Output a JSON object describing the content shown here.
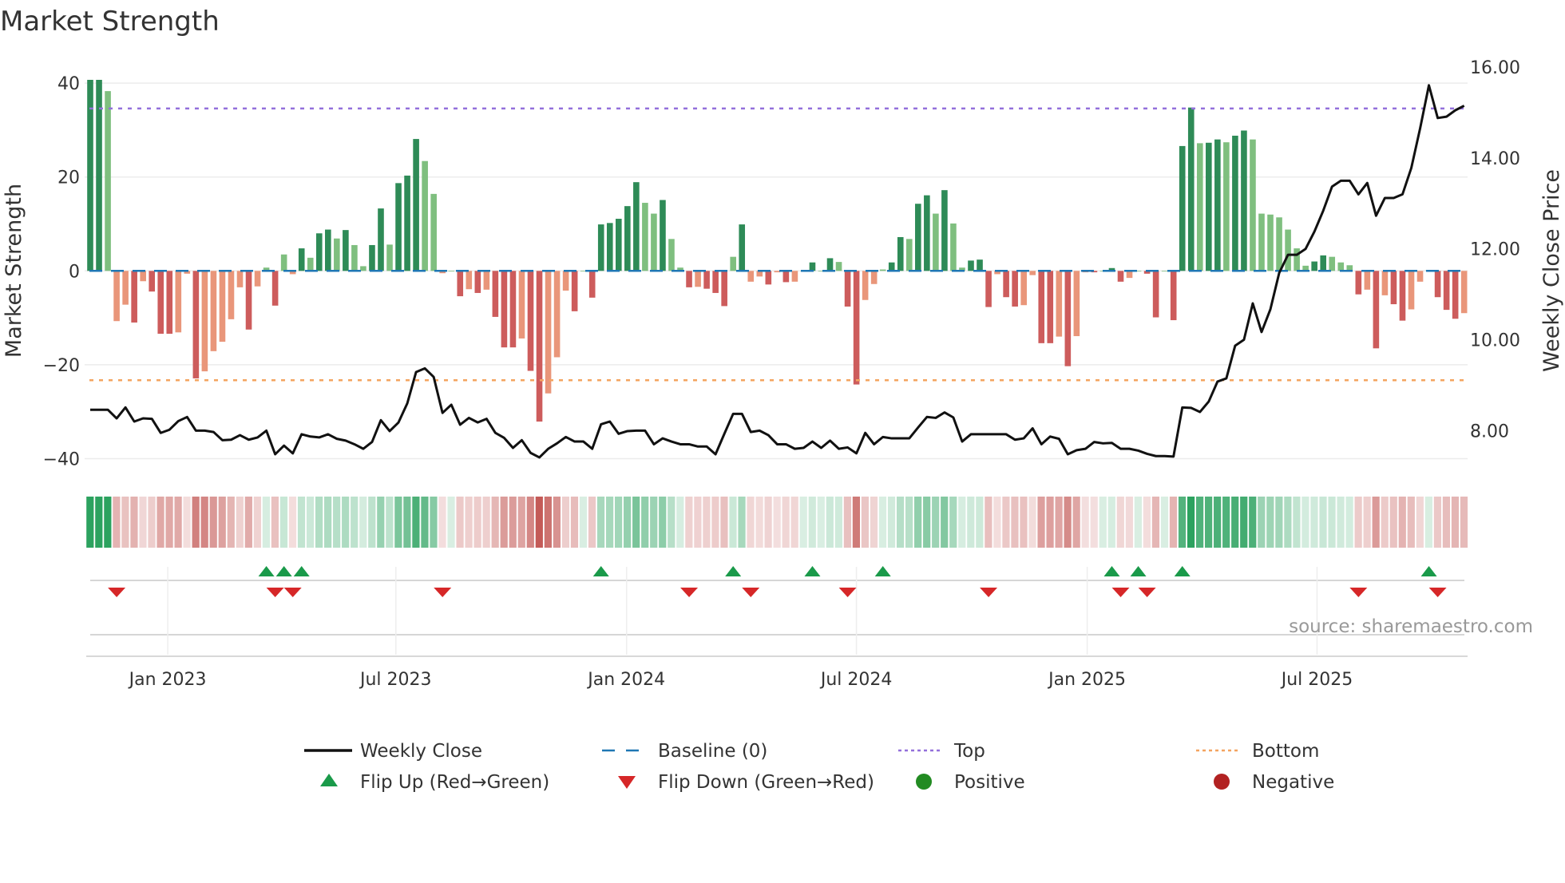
{
  "title": "Market Strength",
  "source": "source: sharemaestro.com",
  "colors": {
    "strong_green": "#2e8b57",
    "weak_green": "#7fbf7f",
    "strong_red": "#cd5c5c",
    "weak_red": "#e9967a",
    "baseline": "#1f77b4",
    "top": "#9370db",
    "bottom": "#f4a460",
    "close": "#111111",
    "flip_up": "#1a9a4a",
    "flip_down": "#d62728",
    "heat_green": "#2ca25f",
    "heat_red": "#c0504d",
    "positive": "#228b22",
    "negative": "#b22222"
  },
  "chart_data": {
    "type": "bar",
    "title": "Market Strength",
    "ylabel": "Market Strength",
    "y2label": "Weekly Close Price",
    "ylim": [
      -44,
      40.7
    ],
    "y2lim": [
      6.97,
      15.72
    ],
    "yticks": [
      {
        "v": 40,
        "label": "40"
      },
      {
        "v": 20,
        "label": "20"
      },
      {
        "v": 0,
        "label": "0"
      },
      {
        "v": -20,
        "label": "−20"
      },
      {
        "v": -40,
        "label": "−40"
      }
    ],
    "y2ticks": [
      {
        "v": 16,
        "label": "16.00"
      },
      {
        "v": 14,
        "label": "14.00"
      },
      {
        "v": 12,
        "label": "12.00"
      },
      {
        "v": 10,
        "label": "10.00"
      },
      {
        "v": 8,
        "label": "8.00"
      }
    ],
    "xticks": [
      {
        "week": 9.8,
        "label": "Jan 2023"
      },
      {
        "week": 35.7,
        "label": "Jul 2023"
      },
      {
        "week": 61.9,
        "label": "Jan 2024"
      },
      {
        "week": 88.0,
        "label": "Jul 2024"
      },
      {
        "week": 114.2,
        "label": "Jan 2025"
      },
      {
        "week": 140.3,
        "label": "Jul 2025"
      }
    ],
    "top_level": 34.6,
    "bottom_level": -23.3,
    "baseline": 0,
    "strength": [
      40.7,
      40.7,
      38.3,
      -10.7,
      -7.2,
      -11,
      -2.2,
      -4.4,
      -13.4,
      -13.4,
      -13.1,
      -0.6,
      -22.9,
      -21.4,
      -17.1,
      -15.1,
      -10.3,
      -3.5,
      -12.5,
      -3.3,
      0.7,
      -7.4,
      3.5,
      -0.7,
      4.8,
      2.8,
      8,
      8.8,
      6.9,
      8.7,
      5.5,
      1,
      5.5,
      13.3,
      5.6,
      18.7,
      20.3,
      28.1,
      23.4,
      16.4,
      -0.5,
      0,
      -5.4,
      -3.9,
      -4.7,
      -4,
      -9.8,
      -16.3,
      -16.3,
      -14.4,
      -21.3,
      -32.1,
      -26.1,
      -18.4,
      -4.2,
      -8.6,
      0,
      -5.7,
      9.9,
      10.2,
      11.1,
      13.8,
      18.9,
      14.5,
      12.2,
      15.1,
      6.8,
      0.7,
      -3.5,
      -3.4,
      -3.8,
      -4.7,
      -7.5,
      3,
      9.9,
      -2.3,
      -1.2,
      -2.9,
      -0.3,
      -2.4,
      -2.3,
      0,
      1.8,
      0,
      2.7,
      1.9,
      -7.6,
      -24.2,
      -6.2,
      -2.8,
      0.3,
      1.8,
      7.2,
      6.8,
      14.3,
      16.1,
      12.2,
      17.2,
      10.1,
      0.7,
      2.2,
      2.4,
      -7.7,
      -0.7,
      -5.6,
      -7.6,
      -7.3,
      -0.9,
      -15.4,
      -15.4,
      -14,
      -20.3,
      -13.9,
      -0.3,
      -0.3,
      0,
      0.6,
      -2.3,
      -1.5,
      0,
      -0.6,
      -9.9,
      0,
      -10.5,
      26.6,
      34.8,
      27.2,
      27.3,
      28,
      27.4,
      28.8,
      29.9,
      28,
      12.2,
      12,
      11.4,
      8.8,
      4.8,
      1.1,
      2,
      3.3,
      3,
      1.8,
      1.2,
      -5,
      -4,
      -16.5,
      -5.2,
      -7.1,
      -10.6,
      -8.2,
      -2.3,
      0.2,
      -5.6,
      -8.3,
      -10.2,
      -9
    ],
    "weekly_close": [
      8.46,
      8.46,
      8.46,
      8.27,
      8.51,
      8.2,
      8.27,
      8.26,
      7.95,
      8.02,
      8.21,
      8.3,
      8.0,
      8.0,
      7.97,
      7.79,
      7.8,
      7.9,
      7.8,
      7.85,
      8.0,
      7.48,
      7.67,
      7.5,
      7.92,
      7.87,
      7.85,
      7.92,
      7.82,
      7.78,
      7.7,
      7.6,
      7.75,
      8.23,
      7.99,
      8.18,
      8.6,
      9.29,
      9.37,
      9.18,
      8.39,
      8.57,
      8.13,
      8.28,
      8.18,
      8.26,
      7.95,
      7.84,
      7.62,
      7.79,
      7.51,
      7.41,
      7.6,
      7.72,
      7.86,
      7.76,
      7.76,
      7.6,
      8.14,
      8.2,
      7.93,
      7.99,
      8.0,
      8.0,
      7.7,
      7.83,
      7.76,
      7.7,
      7.7,
      7.65,
      7.65,
      7.48,
      7.93,
      8.37,
      8.37,
      7.97,
      8.0,
      7.9,
      7.7,
      7.7,
      7.6,
      7.62,
      7.76,
      7.62,
      7.78,
      7.6,
      7.63,
      7.5,
      7.95,
      7.7,
      7.86,
      7.83,
      7.83,
      7.83,
      8.07,
      8.3,
      8.28,
      8.4,
      8.29,
      7.76,
      7.92,
      7.92,
      7.92,
      7.92,
      7.92,
      7.8,
      7.83,
      8.05,
      7.7,
      7.87,
      7.82,
      7.48,
      7.57,
      7.6,
      7.75,
      7.72,
      7.73,
      7.6,
      7.6,
      7.56,
      7.49,
      7.44,
      7.44,
      7.43,
      8.51,
      8.5,
      8.41,
      8.64,
      9.08,
      9.15,
      9.87,
      10.0,
      10.8,
      10.17,
      10.67,
      11.47,
      11.87,
      11.87,
      12.0,
      12.38,
      12.84,
      13.37,
      13.5,
      13.5,
      13.2,
      13.45,
      12.73,
      13.12,
      13.12,
      13.2,
      13.78,
      14.65,
      15.6,
      14.88,
      14.91,
      15.05,
      15.15
    ],
    "flip_up_weeks": [
      21,
      23,
      25,
      59,
      74,
      83,
      91,
      117,
      120,
      125,
      153
    ],
    "flip_down_weeks": [
      4,
      22,
      24,
      41,
      69,
      76,
      87,
      103,
      118,
      121,
      145,
      154
    ],
    "legend": [
      {
        "label": "Weekly Close",
        "kind": "line"
      },
      {
        "label": "Baseline (0)",
        "kind": "baseline"
      },
      {
        "label": "Top",
        "kind": "top"
      },
      {
        "label": "Bottom",
        "kind": "bottom"
      },
      {
        "label": "Flip Up (Red→Green)",
        "kind": "up"
      },
      {
        "label": "Flip Down (Green→Red)",
        "kind": "down"
      },
      {
        "label": "Positive",
        "kind": "pos"
      },
      {
        "label": "Negative",
        "kind": "neg"
      }
    ],
    "legend_position": "bottom-center"
  }
}
